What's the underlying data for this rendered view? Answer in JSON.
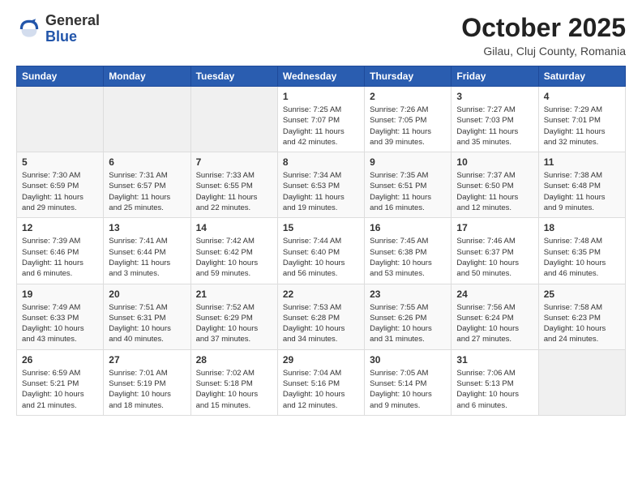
{
  "header": {
    "logo_line1": "General",
    "logo_line2": "Blue",
    "month": "October 2025",
    "location": "Gilau, Cluj County, Romania"
  },
  "days_of_week": [
    "Sunday",
    "Monday",
    "Tuesday",
    "Wednesday",
    "Thursday",
    "Friday",
    "Saturday"
  ],
  "weeks": [
    [
      {
        "day": "",
        "info": ""
      },
      {
        "day": "",
        "info": ""
      },
      {
        "day": "",
        "info": ""
      },
      {
        "day": "1",
        "info": "Sunrise: 7:25 AM\nSunset: 7:07 PM\nDaylight: 11 hours\nand 42 minutes."
      },
      {
        "day": "2",
        "info": "Sunrise: 7:26 AM\nSunset: 7:05 PM\nDaylight: 11 hours\nand 39 minutes."
      },
      {
        "day": "3",
        "info": "Sunrise: 7:27 AM\nSunset: 7:03 PM\nDaylight: 11 hours\nand 35 minutes."
      },
      {
        "day": "4",
        "info": "Sunrise: 7:29 AM\nSunset: 7:01 PM\nDaylight: 11 hours\nand 32 minutes."
      }
    ],
    [
      {
        "day": "5",
        "info": "Sunrise: 7:30 AM\nSunset: 6:59 PM\nDaylight: 11 hours\nand 29 minutes."
      },
      {
        "day": "6",
        "info": "Sunrise: 7:31 AM\nSunset: 6:57 PM\nDaylight: 11 hours\nand 25 minutes."
      },
      {
        "day": "7",
        "info": "Sunrise: 7:33 AM\nSunset: 6:55 PM\nDaylight: 11 hours\nand 22 minutes."
      },
      {
        "day": "8",
        "info": "Sunrise: 7:34 AM\nSunset: 6:53 PM\nDaylight: 11 hours\nand 19 minutes."
      },
      {
        "day": "9",
        "info": "Sunrise: 7:35 AM\nSunset: 6:51 PM\nDaylight: 11 hours\nand 16 minutes."
      },
      {
        "day": "10",
        "info": "Sunrise: 7:37 AM\nSunset: 6:50 PM\nDaylight: 11 hours\nand 12 minutes."
      },
      {
        "day": "11",
        "info": "Sunrise: 7:38 AM\nSunset: 6:48 PM\nDaylight: 11 hours\nand 9 minutes."
      }
    ],
    [
      {
        "day": "12",
        "info": "Sunrise: 7:39 AM\nSunset: 6:46 PM\nDaylight: 11 hours\nand 6 minutes."
      },
      {
        "day": "13",
        "info": "Sunrise: 7:41 AM\nSunset: 6:44 PM\nDaylight: 11 hours\nand 3 minutes."
      },
      {
        "day": "14",
        "info": "Sunrise: 7:42 AM\nSunset: 6:42 PM\nDaylight: 10 hours\nand 59 minutes."
      },
      {
        "day": "15",
        "info": "Sunrise: 7:44 AM\nSunset: 6:40 PM\nDaylight: 10 hours\nand 56 minutes."
      },
      {
        "day": "16",
        "info": "Sunrise: 7:45 AM\nSunset: 6:38 PM\nDaylight: 10 hours\nand 53 minutes."
      },
      {
        "day": "17",
        "info": "Sunrise: 7:46 AM\nSunset: 6:37 PM\nDaylight: 10 hours\nand 50 minutes."
      },
      {
        "day": "18",
        "info": "Sunrise: 7:48 AM\nSunset: 6:35 PM\nDaylight: 10 hours\nand 46 minutes."
      }
    ],
    [
      {
        "day": "19",
        "info": "Sunrise: 7:49 AM\nSunset: 6:33 PM\nDaylight: 10 hours\nand 43 minutes."
      },
      {
        "day": "20",
        "info": "Sunrise: 7:51 AM\nSunset: 6:31 PM\nDaylight: 10 hours\nand 40 minutes."
      },
      {
        "day": "21",
        "info": "Sunrise: 7:52 AM\nSunset: 6:29 PM\nDaylight: 10 hours\nand 37 minutes."
      },
      {
        "day": "22",
        "info": "Sunrise: 7:53 AM\nSunset: 6:28 PM\nDaylight: 10 hours\nand 34 minutes."
      },
      {
        "day": "23",
        "info": "Sunrise: 7:55 AM\nSunset: 6:26 PM\nDaylight: 10 hours\nand 31 minutes."
      },
      {
        "day": "24",
        "info": "Sunrise: 7:56 AM\nSunset: 6:24 PM\nDaylight: 10 hours\nand 27 minutes."
      },
      {
        "day": "25",
        "info": "Sunrise: 7:58 AM\nSunset: 6:23 PM\nDaylight: 10 hours\nand 24 minutes."
      }
    ],
    [
      {
        "day": "26",
        "info": "Sunrise: 6:59 AM\nSunset: 5:21 PM\nDaylight: 10 hours\nand 21 minutes."
      },
      {
        "day": "27",
        "info": "Sunrise: 7:01 AM\nSunset: 5:19 PM\nDaylight: 10 hours\nand 18 minutes."
      },
      {
        "day": "28",
        "info": "Sunrise: 7:02 AM\nSunset: 5:18 PM\nDaylight: 10 hours\nand 15 minutes."
      },
      {
        "day": "29",
        "info": "Sunrise: 7:04 AM\nSunset: 5:16 PM\nDaylight: 10 hours\nand 12 minutes."
      },
      {
        "day": "30",
        "info": "Sunrise: 7:05 AM\nSunset: 5:14 PM\nDaylight: 10 hours\nand 9 minutes."
      },
      {
        "day": "31",
        "info": "Sunrise: 7:06 AM\nSunset: 5:13 PM\nDaylight: 10 hours\nand 6 minutes."
      },
      {
        "day": "",
        "info": ""
      }
    ]
  ]
}
